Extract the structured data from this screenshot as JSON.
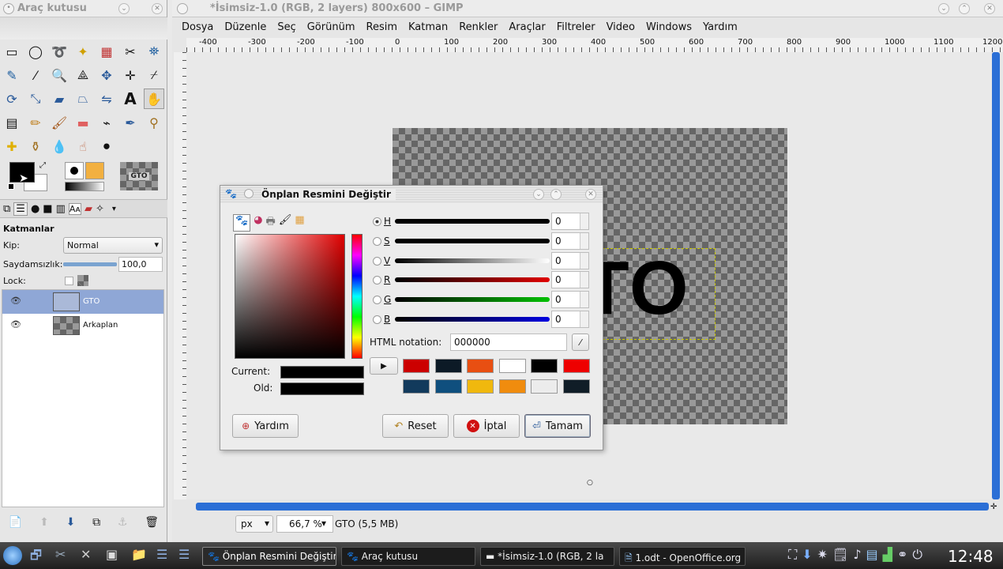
{
  "toolbox": {
    "title": "Araç kutusu",
    "layers_title": "Katmanlar",
    "mode_label": "Kip:",
    "mode_value": "Normal",
    "opacity_label": "Saydamsızlık:",
    "opacity_value": "100,0",
    "opacity_fraction": 1.0,
    "lock_label": "Lock:",
    "brush_preview_text": "GTO",
    "layers": [
      {
        "name": "GTO",
        "selected": true
      },
      {
        "name": "Arkaplan",
        "selected": false
      }
    ]
  },
  "gimp_window": {
    "title": "*İsimsiz-1.0 (RGB, 2 layers) 800x600 – GIMP",
    "menu": [
      "Dosya",
      "Düzenle",
      "Seç",
      "Görünüm",
      "Resim",
      "Katman",
      "Renkler",
      "Araçlar",
      "Filtreler",
      "Video",
      "Windows",
      "Yardım"
    ],
    "ruler_labels": [
      "-400",
      "-300",
      "-200",
      "-100",
      "0",
      "100",
      "200",
      "300",
      "400",
      "500",
      "600",
      "700",
      "800",
      "900",
      "1000",
      "1100",
      "1200"
    ],
    "canvas_text": "TO",
    "status": {
      "unit": "px",
      "zoom": "66,7 %",
      "info": "GTO (5,5 MB)"
    }
  },
  "color_dialog": {
    "title": "Önplan Resmini Değiştir",
    "channels": [
      {
        "label": "H",
        "value": "0",
        "selected": true,
        "color": "#000000"
      },
      {
        "label": "S",
        "value": "0",
        "selected": false,
        "color": "#000000"
      },
      {
        "label": "V",
        "value": "0",
        "selected": false,
        "color": "#ffffff"
      },
      {
        "label": "R",
        "value": "0",
        "selected": false,
        "color": "#e00000"
      },
      {
        "label": "G",
        "value": "0",
        "selected": false,
        "color": "#00c000"
      },
      {
        "label": "B",
        "value": "0",
        "selected": false,
        "color": "#0000e0"
      }
    ],
    "html_notation_label": "HTML notation:",
    "html_notation_value": "000000",
    "current_label": "Current:",
    "old_label": "Old:",
    "current_color": "#000000",
    "old_color": "#000000",
    "history_colors": [
      "#cc0000",
      "#0c1a26",
      "#e84f12",
      "#ffffff",
      "#000000",
      "#ee0000",
      "#123a5c",
      "#0f4f7e",
      "#f0b80e",
      "#f08c0e",
      "#ececec",
      "#101d27"
    ],
    "buttons": {
      "help": "Yardım",
      "reset": "Reset",
      "cancel": "İptal",
      "ok": "Tamam"
    }
  },
  "taskbar": {
    "tasks": [
      "Önplan Resmini Değiştir",
      "Araç kutusu",
      "*İsimsiz-1.0 (RGB, 2 la",
      "1.odt - OpenOffice.org"
    ],
    "clock": "12:48"
  }
}
